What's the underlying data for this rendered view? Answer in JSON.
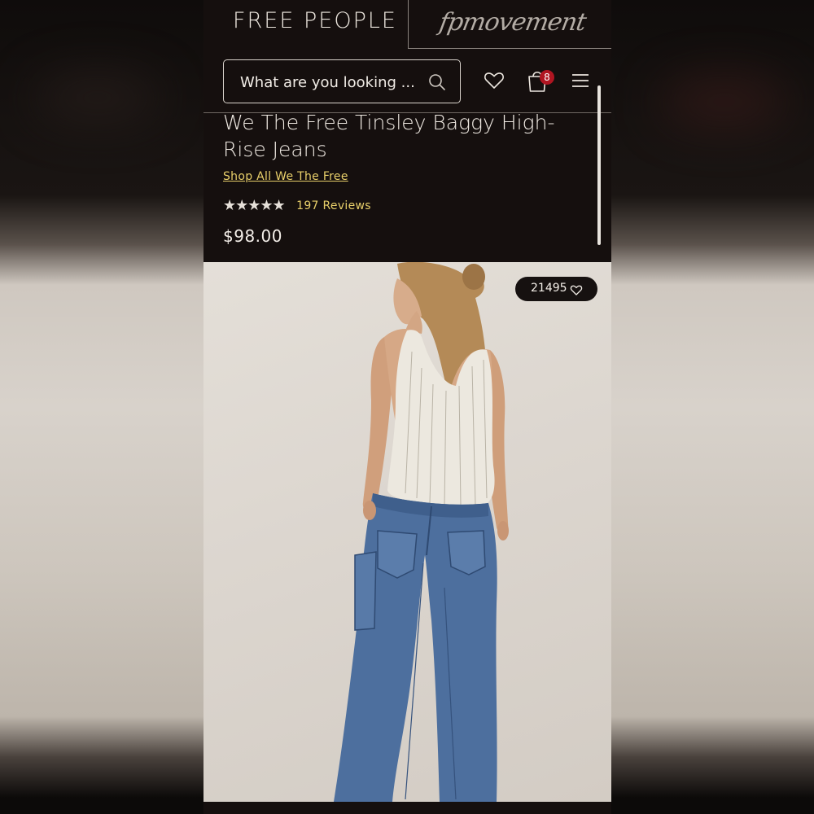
{
  "header": {
    "brand": "FREE PEOPLE",
    "movement_logo": "fpmovement"
  },
  "search": {
    "placeholder": "What are you looking ..."
  },
  "cart": {
    "count": "8"
  },
  "product": {
    "title": "We The Free Tinsley Baggy High-Rise Jeans",
    "shop_link": "Shop All We The Free",
    "rating": 5,
    "stars": "★★★★★",
    "reviews": "197 Reviews",
    "price": "$98.00",
    "likes": "21495"
  },
  "colors": {
    "background": "#150f0e",
    "text": "#efe9e2",
    "link": "#e8cf6a",
    "badge": "#b01521"
  }
}
